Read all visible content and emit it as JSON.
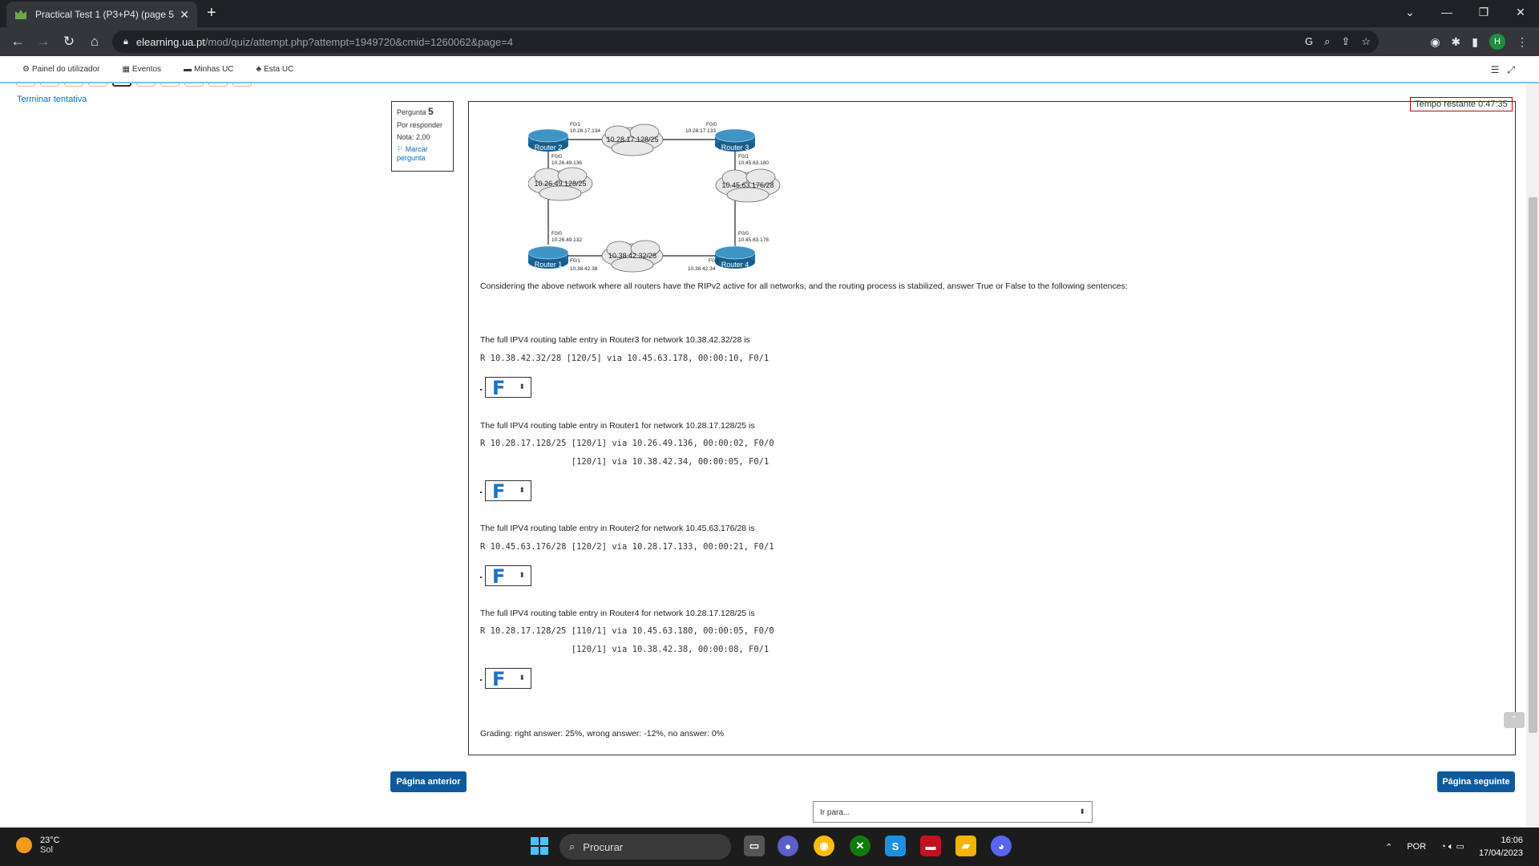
{
  "browser": {
    "tab_title": "Practical Test 1 (P3+P4) (page 5 o",
    "url_host": "elearning.ua.pt",
    "url_path": "/mod/quiz/attempt.php?attempt=1949720&cmid=1260062&page=4",
    "profile_initial": "H"
  },
  "moodle_nav": {
    "items": [
      "Painel do utilizador",
      "Eventos",
      "Minhas UC",
      "Esta UC"
    ]
  },
  "quiz": {
    "finish_link": "Terminar tentativa",
    "info": {
      "label": "Pergunta",
      "number": "5",
      "status": "Por responder",
      "grade": "Nota: 2,00",
      "flag": "Marcar pergunta"
    },
    "timer": "Tempo restante 0:47:35",
    "diagram": {
      "routers": [
        "Router 1",
        "Router 2",
        "Router 3",
        "Router 4"
      ],
      "networks": [
        "10.28.17.128/25",
        "10.26.49.128/25",
        "10.45.63.176/28",
        "10.38.42.32/28"
      ],
      "labels": {
        "r2_f01": "F0/1",
        "r2_f01_ip": "10.28.17.134",
        "r3_f00": "F0/0",
        "r3_f00_ip": "10.28.17.133",
        "r2_f00": "F0/0",
        "r2_f00_ip": "10.26.49.136",
        "r3_f01": "F0/1",
        "r3_f01_ip": "10.45.63.180",
        "r1_f00": "F0/0",
        "r1_f00_ip": "10.26.49.132",
        "r4_f00": "F0/0",
        "r4_f00_ip": "10.45.63.178",
        "r1_f01": "F0/1",
        "r1_f01_ip": "10.38.42.38",
        "r4_f01": "F0/1",
        "r4_f01_ip": "10.38.42.34"
      }
    },
    "intro": "Considering the above network where all routers have the RIPv2 active for all networks, and the routing process is stabilized, answer True or False to the following sentences:",
    "statements": [
      {
        "text": "The full IPV4 routing table entry in Router3 for network 10.38.42.32/28 is",
        "lines": [
          "R 10.38.42.32/28 [120/5] via 10.45.63.178, 00:00:10, F0/1"
        ],
        "answer": "F"
      },
      {
        "text": "The full IPV4 routing table entry in Router1 for network 10.28.17.128/25 is",
        "lines": [
          "R 10.28.17.128/25 [120/1] via 10.26.49.136, 00:00:02, F0/0",
          "                  [120/1] via 10.38.42.34, 00:00:05, F0/1"
        ],
        "answer": "F"
      },
      {
        "text": "The full IPV4 routing table entry in Router2 for network 10.45.63.176/28 is",
        "lines": [
          "R 10.45.63.176/28 [120/2] via 10.28.17.133, 00:00:21, F0/1"
        ],
        "answer": "F"
      },
      {
        "text": "The full IPV4 routing table entry in Router4 for network 10.28.17.128/25 is",
        "lines": [
          "R 10.28.17.128/25 [110/1] via 10.45.63.180, 00:00:05, F0/0",
          "                  [120/1] via 10.38.42.38, 00:00:08, F0/1"
        ],
        "answer": "F"
      }
    ],
    "grading": "Grading: right answer: 25%, wrong answer: -12%, no answer: 0%",
    "prev_button": "Página anterior",
    "next_button": "Página seguinte",
    "goto_placeholder": "Ir para..."
  },
  "taskbar": {
    "temp": "23°C",
    "weather": "Sol",
    "search": "Procurar",
    "lang": "POR",
    "time": "16:06",
    "date": "17/04/2023"
  }
}
